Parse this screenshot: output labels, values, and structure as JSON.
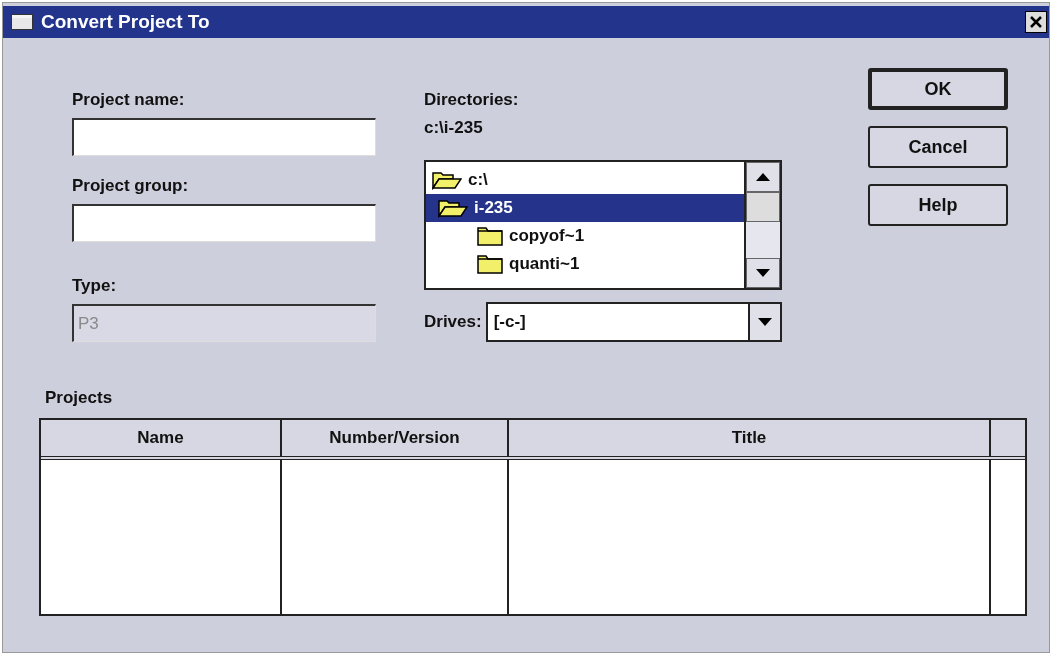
{
  "window": {
    "title": "Convert Project To"
  },
  "fields": [
    {
      "label": "Project name:",
      "disabled": false
    },
    {
      "label": "Project group:",
      "disabled": false
    },
    {
      "label": "Type:",
      "value": "P3",
      "disabled": true
    }
  ],
  "directories": {
    "label": "Directories:",
    "path": "c:\\i-235",
    "items": [
      {
        "name": "c:\\",
        "kind": "open",
        "selected": false,
        "children": [
          {
            "name": "i-235",
            "kind": "open",
            "selected": true,
            "children": [
              {
                "name": "copyof~1",
                "kind": "closed",
                "selected": false
              },
              {
                "name": "quanti~1",
                "kind": "closed",
                "selected": false
              }
            ]
          }
        ]
      }
    ]
  },
  "drives": {
    "label": "Drives:",
    "value": "[-c-]"
  },
  "buttons": [
    {
      "label": "OK",
      "default": true
    },
    {
      "label": "Cancel",
      "default": false
    },
    {
      "label": "Help",
      "default": false
    }
  ],
  "projects": {
    "label": "Projects",
    "columns": [
      "Name",
      "Number/Version",
      "Title"
    ]
  }
}
